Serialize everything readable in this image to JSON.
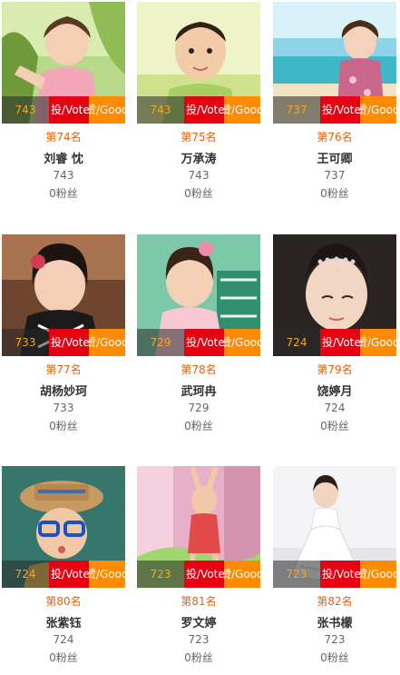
{
  "labels": {
    "vote": "投/Vote",
    "good": "赞/Good"
  },
  "cards": [
    {
      "votes": "743",
      "rank": "第74名",
      "name": "刘睿 忱",
      "count": "743",
      "fans": "0粉丝"
    },
    {
      "votes": "743",
      "rank": "第75名",
      "name": "万承涛",
      "count": "743",
      "fans": "0粉丝"
    },
    {
      "votes": "737",
      "rank": "第76名",
      "name": "王可卿",
      "count": "737",
      "fans": "0粉丝"
    },
    {
      "votes": "733",
      "rank": "第77名",
      "name": "胡杨妙珂",
      "count": "733",
      "fans": "0粉丝"
    },
    {
      "votes": "729",
      "rank": "第78名",
      "name": "武珂冉",
      "count": "729",
      "fans": "0粉丝"
    },
    {
      "votes": "724",
      "rank": "第79名",
      "name": "饶婷月",
      "count": "724",
      "fans": "0粉丝"
    },
    {
      "votes": "724",
      "rank": "第80名",
      "name": "张紫钰",
      "count": "724",
      "fans": "0粉丝"
    },
    {
      "votes": "723",
      "rank": "第81名",
      "name": "罗文婷",
      "count": "723",
      "fans": "0粉丝"
    },
    {
      "votes": "723",
      "rank": "第82名",
      "name": "张书檬",
      "count": "723",
      "fans": "0粉丝"
    }
  ],
  "colors": {
    "rank_text": "#e8600c",
    "vote_button": "#e60012",
    "good_button": "#ff8c00",
    "votes_text": "#f5a623"
  }
}
